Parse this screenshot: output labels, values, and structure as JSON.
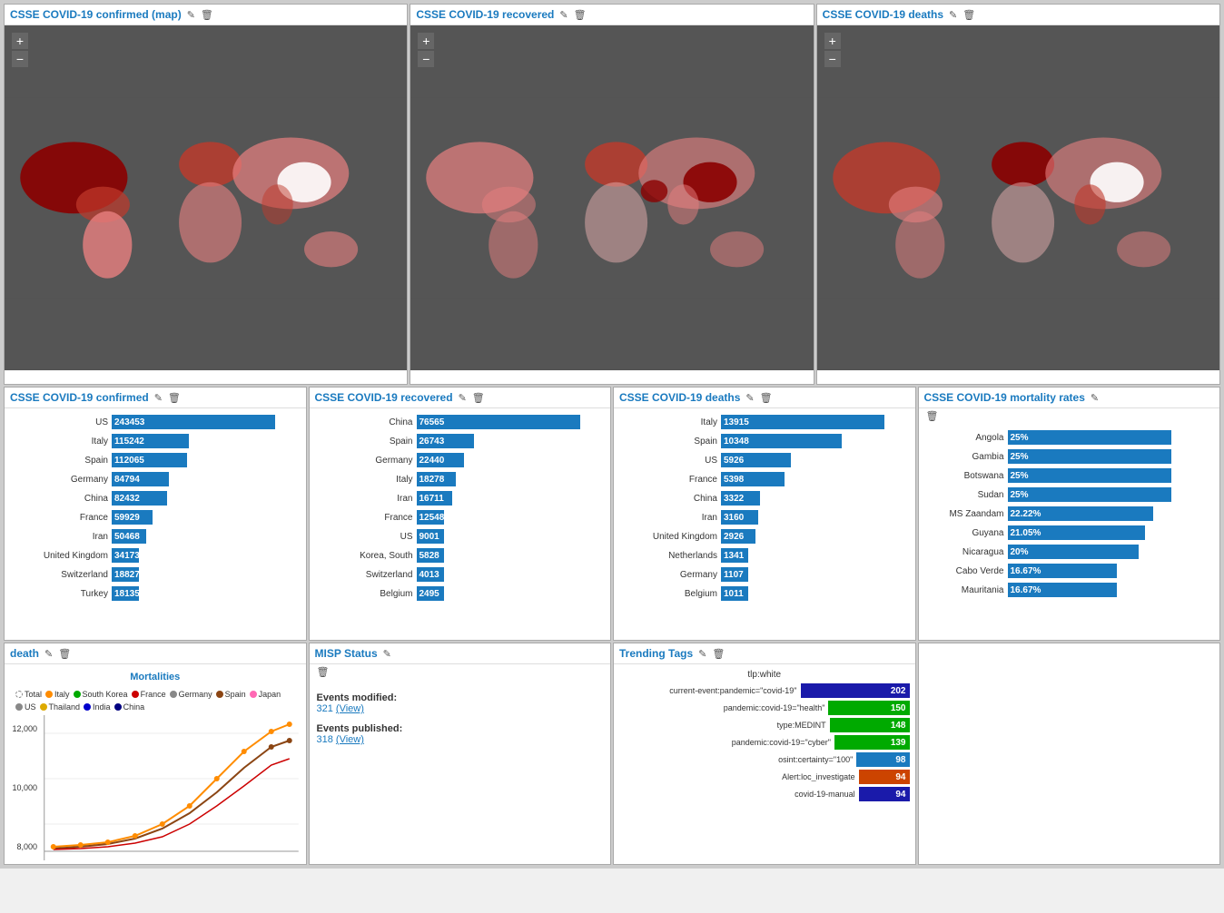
{
  "maps": [
    {
      "title": "CSSE COVID-19 confirmed (map)",
      "id": "map-confirmed"
    },
    {
      "title": "CSSE COVID-19 recovered",
      "id": "map-recovered"
    },
    {
      "title": "CSSE COVID-19 deaths",
      "id": "map-deaths"
    }
  ],
  "confirmed": {
    "title": "CSSE COVID-19 confirmed",
    "edit_icon": "✎",
    "delete_icon": "🗑",
    "rows": [
      {
        "label": "US",
        "value": "243453",
        "pct": 100
      },
      {
        "label": "Italy",
        "value": "115242",
        "pct": 47
      },
      {
        "label": "Spain",
        "value": "112065",
        "pct": 46
      },
      {
        "label": "Germany",
        "value": "84794",
        "pct": 35
      },
      {
        "label": "China",
        "value": "82432",
        "pct": 34
      },
      {
        "label": "France",
        "value": "59929",
        "pct": 25
      },
      {
        "label": "Iran",
        "value": "50468",
        "pct": 21
      },
      {
        "label": "United Kingdom",
        "value": "34173",
        "pct": 14
      },
      {
        "label": "Switzerland",
        "value": "18827",
        "pct": 8
      },
      {
        "label": "Turkey",
        "value": "18135",
        "pct": 7
      }
    ]
  },
  "recovered": {
    "title": "CSSE COVID-19 recovered",
    "rows": [
      {
        "label": "China",
        "value": "76565",
        "pct": 100
      },
      {
        "label": "Spain",
        "value": "26743",
        "pct": 35
      },
      {
        "label": "Germany",
        "value": "22440",
        "pct": 29
      },
      {
        "label": "Italy",
        "value": "18278",
        "pct": 24
      },
      {
        "label": "Iran",
        "value": "16711",
        "pct": 22
      },
      {
        "label": "France",
        "value": "12548",
        "pct": 16
      },
      {
        "label": "US",
        "value": "9001",
        "pct": 12
      },
      {
        "label": "Korea, South",
        "value": "5828",
        "pct": 8
      },
      {
        "label": "Switzerland",
        "value": "4013",
        "pct": 5
      },
      {
        "label": "Belgium",
        "value": "2495",
        "pct": 3
      }
    ]
  },
  "deaths": {
    "title": "CSSE COVID-19 deaths",
    "rows": [
      {
        "label": "Italy",
        "value": "13915",
        "pct": 100
      },
      {
        "label": "Spain",
        "value": "10348",
        "pct": 74
      },
      {
        "label": "US",
        "value": "5926",
        "pct": 43
      },
      {
        "label": "France",
        "value": "5398",
        "pct": 39
      },
      {
        "label": "China",
        "value": "3322",
        "pct": 24
      },
      {
        "label": "Iran",
        "value": "3160",
        "pct": 23
      },
      {
        "label": "United Kingdom",
        "value": "2926",
        "pct": 21
      },
      {
        "label": "Netherlands",
        "value": "1341",
        "pct": 10
      },
      {
        "label": "Germany",
        "value": "1107",
        "pct": 8
      },
      {
        "label": "Belgium",
        "value": "1011",
        "pct": 7
      }
    ]
  },
  "mortality": {
    "title": "CSSE COVID-19 mortality rates",
    "rows": [
      {
        "label": "Angola",
        "value": "25%",
        "pct": 100
      },
      {
        "label": "Gambia",
        "value": "25%",
        "pct": 100
      },
      {
        "label": "Botswana",
        "value": "25%",
        "pct": 100
      },
      {
        "label": "Sudan",
        "value": "25%",
        "pct": 100
      },
      {
        "label": "MS Zaandam",
        "value": "22.22%",
        "pct": 89
      },
      {
        "label": "Guyana",
        "value": "21.05%",
        "pct": 84
      },
      {
        "label": "Nicaragua",
        "value": "20%",
        "pct": 80
      },
      {
        "label": "Cabo Verde",
        "value": "16.67%",
        "pct": 67
      },
      {
        "label": "Mauritania",
        "value": "16.67%",
        "pct": 67
      }
    ]
  },
  "death_chart": {
    "title": "death",
    "chart_title": "Mortalities",
    "legend": [
      {
        "label": "Total",
        "color": "#888888",
        "style": "dashed"
      },
      {
        "label": "Italy",
        "color": "#ff8c00"
      },
      {
        "label": "South Korea",
        "color": "#00aa00"
      },
      {
        "label": "France",
        "color": "#cc0000"
      },
      {
        "label": "Germany",
        "color": "#888888"
      },
      {
        "label": "Spain",
        "color": "#8b4513"
      },
      {
        "label": "Japan",
        "color": "#ff69b4"
      },
      {
        "label": "US",
        "color": "#888888"
      },
      {
        "label": "Thailand",
        "color": "#ddaa00"
      },
      {
        "label": "India",
        "color": "#0000cc"
      },
      {
        "label": "China",
        "color": "#000080"
      }
    ],
    "y_labels": [
      "12,000",
      "10,000",
      "8,000"
    ]
  },
  "misp": {
    "title": "MISP Status",
    "events_modified_label": "Events modified:",
    "events_modified_value": "321",
    "events_modified_link": "View",
    "events_published_label": "Events published:",
    "events_published_value": "318",
    "events_published_link": "View"
  },
  "trending": {
    "title": "Trending Tags",
    "tlp_label": "tlp:white",
    "tags": [
      {
        "label": "current-event:pandemic=\"covid-19\"",
        "value": "202",
        "color": "#1a1aaa"
      },
      {
        "label": "pandemic:covid-19=\"health\"",
        "value": "150",
        "color": "#00aa00"
      },
      {
        "label": "type:MEDINT",
        "value": "148",
        "color": "#00aa00"
      },
      {
        "label": "pandemic:covid-19=\"cyber\"",
        "value": "139",
        "color": "#00aa00"
      },
      {
        "label": "osint:certainty=\"100\"",
        "value": "98",
        "color": "#1a7abf"
      },
      {
        "label": "Alert:loc_investigate",
        "value": "94",
        "color": "#cc4400"
      },
      {
        "label": "covid-19-manual",
        "value": "94",
        "color": "#1a1aaa"
      }
    ]
  },
  "icons": {
    "edit": "✎",
    "delete": "🗑",
    "plus": "+",
    "minus": "−"
  }
}
